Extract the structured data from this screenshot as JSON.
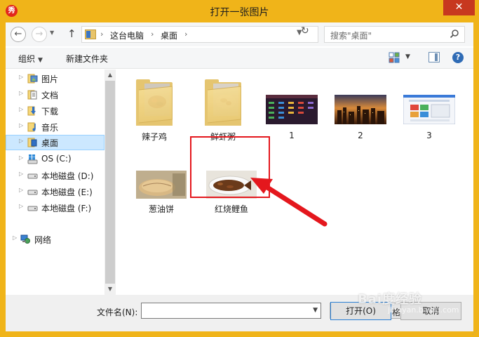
{
  "window": {
    "title": "打开一张图片",
    "app_icon_text": "秀",
    "close_glyph": "✕"
  },
  "address": {
    "segments": [
      "这台电脑",
      "桌面"
    ],
    "search_placeholder": "搜索\"桌面\""
  },
  "toolbar": {
    "organize_label": "组织",
    "new_folder_label": "新建文件夹"
  },
  "nav": {
    "items": [
      {
        "label": "图片",
        "icon": "pictures-icon"
      },
      {
        "label": "文档",
        "icon": "documents-icon"
      },
      {
        "label": "下载",
        "icon": "downloads-icon"
      },
      {
        "label": "音乐",
        "icon": "music-icon"
      },
      {
        "label": "桌面",
        "icon": "desktop-icon",
        "selected": true
      },
      {
        "label": "OS (C:)",
        "icon": "os-drive-icon"
      },
      {
        "label": "本地磁盘 (D:)",
        "icon": "disk-drive-icon"
      },
      {
        "label": "本地磁盘 (E:)",
        "icon": "disk-drive-icon"
      },
      {
        "label": "本地磁盘 (F:)",
        "icon": "disk-drive-icon"
      },
      {
        "label": "网络",
        "icon": "network-icon"
      }
    ]
  },
  "files": [
    {
      "name": "辣子鸡",
      "type": "folder"
    },
    {
      "name": "鲜虾粥",
      "type": "folder"
    },
    {
      "name": "1",
      "type": "image"
    },
    {
      "name": "2",
      "type": "image"
    },
    {
      "name": "3",
      "type": "image"
    },
    {
      "name": "葱油饼",
      "type": "image"
    },
    {
      "name": "红烧鲤鱼",
      "type": "image",
      "highlighted": true
    }
  ],
  "bottom": {
    "filename_label": "文件名(N):",
    "filename_value": "",
    "filter_value": "所有支持的图片格式",
    "open_label": "打开(O)",
    "cancel_label": "取消"
  },
  "watermark": {
    "text": "Bai度经验",
    "sub": "jingyan.baidu.com"
  },
  "colors": {
    "title_bar": "#f0b419",
    "close_button": "#c7381f",
    "annotation_red": "#e4171d",
    "selection": "#cce8ff"
  }
}
